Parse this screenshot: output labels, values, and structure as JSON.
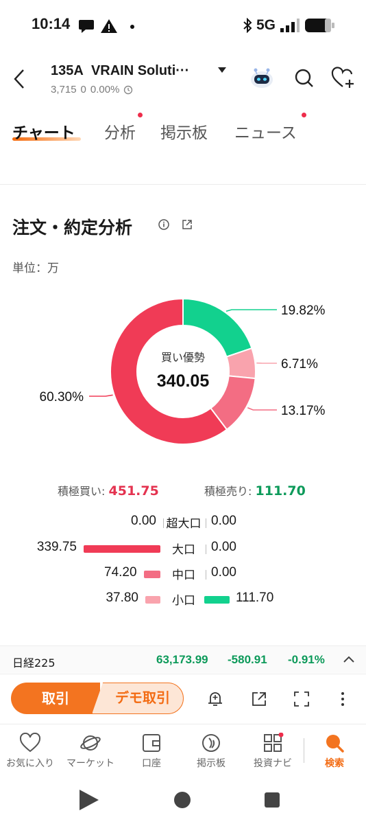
{
  "status": {
    "time": "10:14",
    "network": "5G"
  },
  "header": {
    "code": "135A",
    "name": "VRAIN Soluti···",
    "price": "3,715",
    "change": "0",
    "change_pct": "0.00%"
  },
  "tabs": [
    "チャート",
    "分析",
    "掲示板",
    "ニュース"
  ],
  "section": {
    "title": "注文・約定分析",
    "unit": "単位：万"
  },
  "donut": {
    "center_label": "買い優勢",
    "center_value": "340.05",
    "slices": [
      {
        "label": "19.82%",
        "value": 19.82,
        "color": "#12d18e"
      },
      {
        "label": "6.71%",
        "value": 6.71,
        "color": "#f9a3ad"
      },
      {
        "label": "13.17%",
        "value": 13.17,
        "color": "#f36d83"
      },
      {
        "label": "60.30%",
        "value": 60.3,
        "color": "#f03b56"
      }
    ]
  },
  "summary": {
    "buy_label": "積極買い:",
    "buy_value": "451.75",
    "sell_label": "積極売り:",
    "sell_value": "111.70"
  },
  "breakdown": [
    {
      "category": "超大口",
      "buy": "0.00",
      "sell": "0.00",
      "buy_num": 0,
      "sell_num": 0,
      "buy_color": "#f03b56"
    },
    {
      "category": "大口",
      "buy": "339.75",
      "sell": "0.00",
      "buy_num": 339.75,
      "sell_num": 0,
      "buy_color": "#f03b56"
    },
    {
      "category": "中口",
      "buy": "74.20",
      "sell": "0.00",
      "buy_num": 74.2,
      "sell_num": 0,
      "buy_color": "#f36d83"
    },
    {
      "category": "小口",
      "buy": "37.80",
      "sell": "111.70",
      "buy_num": 37.8,
      "sell_num": 111.7,
      "buy_color": "#f9a3ad"
    }
  ],
  "ticker": {
    "name": "日経225",
    "value": "63,173.99",
    "change": "-580.91",
    "change_pct": "-0.91%"
  },
  "actions": {
    "trade": "取引",
    "demo": "デモ取引"
  },
  "nav": [
    "お気に入り",
    "マーケット",
    "口座",
    "掲示板",
    "投資ナビ",
    "検索"
  ],
  "colors": {
    "accent": "#f37420",
    "buy": "#f03b56",
    "sell": "#12d18e",
    "sell_text": "#0d9a5a"
  }
}
